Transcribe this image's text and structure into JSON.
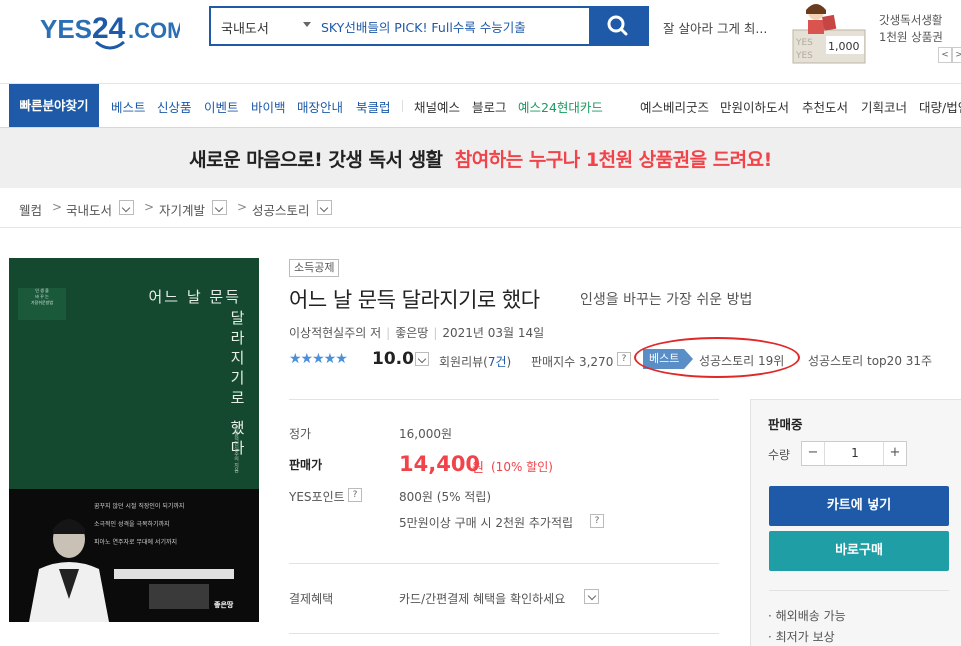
{
  "header": {
    "logo_text": "YES24.COM",
    "search": {
      "category": "국내도서",
      "query": "SKY선배들의 PICK! Full수록 수능기출"
    },
    "rank_text": "잘 살아라 그게 최...",
    "promo": {
      "amount": "1,000",
      "line1": "갓생독서생활",
      "line2": "1천원 상품권",
      "prev_label": "<",
      "next_label": ">"
    }
  },
  "nav": {
    "quick_label": "빠른분야찾기",
    "items": [
      "베스트",
      "신상품",
      "이벤트",
      "바이백",
      "매장안내",
      "북클럽",
      "채널예스",
      "블로그",
      "예스24현대카드",
      "예스베리굿즈",
      "만원이하도서",
      "추천도서",
      "기획코너",
      "대량/법인"
    ]
  },
  "banner": {
    "text": "새로운 마음으로! 갓생 독서 생활",
    "highlight": "참여하는 누구나 1천원 상품권을 드려요!"
  },
  "breadcrumb": [
    "웰컴",
    "국내도서",
    "자기계발",
    "성공스토리"
  ],
  "cover": {
    "title_horizontal": "어느 날 문득",
    "title_vertical": "달라지기로 했다",
    "small_box_lines": [
      "인 생 을",
      "바 꾸 는",
      "가장쉬운방법"
    ],
    "author_vertical": "이상적현실주의 지음",
    "quote_lines": [
      "꿈꾸지 않던 시절 직장인이 되기까지",
      "소극적인 성격을 극복하기까지",
      "피아노 연주자로 무대에 서기까지"
    ],
    "publisher": "좋은땅"
  },
  "product": {
    "tag": "소득공제",
    "title": "어느 날 문득 달라지기로 했다",
    "subtitle": "인생을 바꾸는 가장 쉬운 방법",
    "author": "이상적현실주의 저",
    "publisher": "좋은땅",
    "date": "2021년 03월 14일",
    "stars": "★★★★★",
    "score": "10.0",
    "review_label": "회원리뷰(",
    "review_count": "7건",
    "review_close": ")",
    "sales_index": "판매지수 3,270",
    "help": "?",
    "best_badge": "베스트",
    "best_rank": "성공스토리 19위",
    "top20": "성공스토리 top20 31주"
  },
  "price": {
    "list_label": "정가",
    "list_value": "16,000원",
    "sale_label": "판매가",
    "sale_value": "14,400",
    "sale_unit": "원",
    "sale_rate": "(10% 할인)",
    "points_label": "YES포인트",
    "points_value": "800원 (5% 적립)",
    "extra_points": "5만원이상 구매 시 2천원 추가적립",
    "pay_label": "결제혜택",
    "pay_value": "카드/간편결제 혜택을 확인하세요"
  },
  "buy": {
    "status": "판매중",
    "qty_label": "수량",
    "qty_minus": "−",
    "qty_value": "1",
    "qty_plus": "+",
    "cart_label": "카트에 넣기",
    "buy_label": "바로구매",
    "notes": [
      "· 해외배송 가능",
      "· 최저가 보상"
    ]
  },
  "colors": {
    "brand_blue": "#1e5aa8",
    "accent_red": "#f0434a",
    "buy_teal": "#1f9ea5",
    "green_link": "#1c9a62",
    "star_blue": "#4a90d9",
    "annotation_red": "#e02828"
  },
  "icons": {
    "search": "search-icon",
    "dropdown": "chevron-down-icon",
    "breadcrumb_separator": "chevron-right-icon",
    "help": "question-icon"
  }
}
